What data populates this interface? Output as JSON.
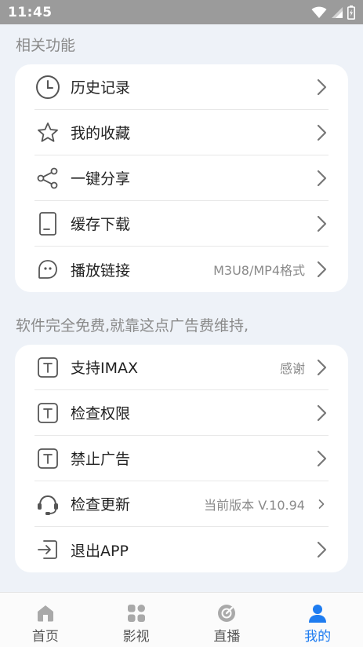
{
  "status_bar": {
    "time": "11:45"
  },
  "section1": {
    "title": "相关功能",
    "items": [
      {
        "icon": "clock-icon",
        "label": "历史记录",
        "value": ""
      },
      {
        "icon": "star-icon",
        "label": "我的收藏",
        "value": ""
      },
      {
        "icon": "share-icon",
        "label": "一键分享",
        "value": ""
      },
      {
        "icon": "storage-icon",
        "label": "缓存下载",
        "value": ""
      },
      {
        "icon": "link-icon",
        "label": "播放链接",
        "value": "M3U8/MP4格式"
      }
    ]
  },
  "section2": {
    "title": "软件完全免费,就靠这点广告费维持,",
    "items": [
      {
        "icon": "t-box-icon",
        "label": "支持IMAX",
        "value": "感谢"
      },
      {
        "icon": "t-box-icon",
        "label": "检查权限",
        "value": ""
      },
      {
        "icon": "t-box-icon",
        "label": "禁止广告",
        "value": ""
      },
      {
        "icon": "headset-icon",
        "label": "检查更新",
        "value": "当前版本  V.10.94"
      },
      {
        "icon": "exit-icon",
        "label": "退出APP",
        "value": ""
      }
    ]
  },
  "bottom_nav": {
    "items": [
      {
        "icon": "home-icon",
        "label": "首页"
      },
      {
        "icon": "grid-icon",
        "label": "影视"
      },
      {
        "icon": "live-icon",
        "label": "直播"
      },
      {
        "icon": "user-icon",
        "label": "我的"
      }
    ],
    "active": "我的",
    "active_color": "#1e7cf0"
  }
}
